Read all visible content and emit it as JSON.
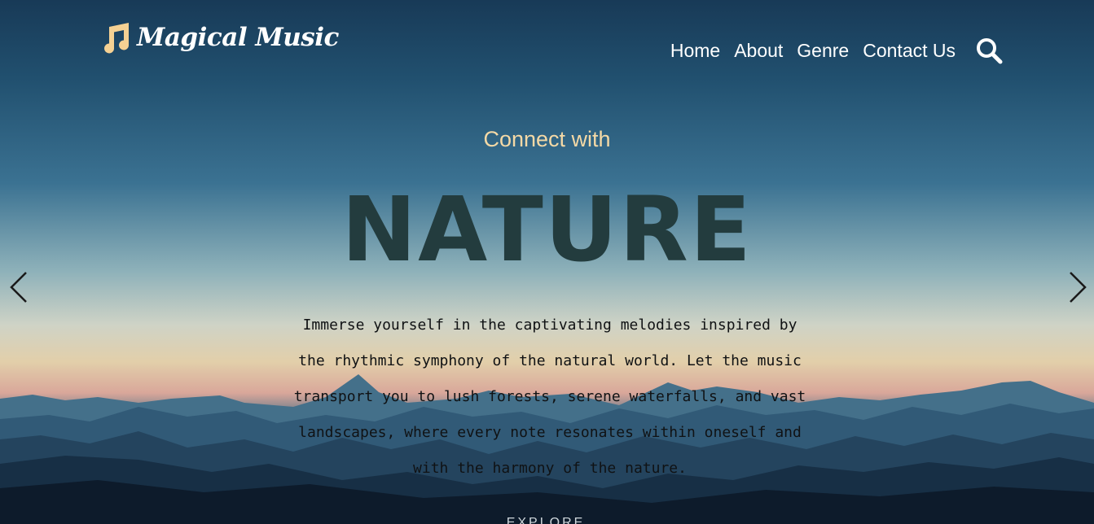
{
  "brand": {
    "name": "Magical Music",
    "icon": "music-note-icon",
    "icon_color": "#f5d193"
  },
  "nav": {
    "items": [
      {
        "label": "Home"
      },
      {
        "label": "About"
      },
      {
        "label": "Genre"
      },
      {
        "label": "Contact Us"
      }
    ],
    "search_icon": "search-icon"
  },
  "hero": {
    "subtitle": "Connect with",
    "headline": "NATURE",
    "description": "Immerse yourself in the captivating melodies inspired by the rhythmic symphony of the natural world. Let the music transport you to lush forests, serene waterfalls, and vast landscapes, where every note resonates within oneself and with the harmony of the nature.",
    "cta_label": "EXPLORE",
    "prev_icon": "chevron-left-icon",
    "next_icon": "chevron-right-icon"
  },
  "colors": {
    "subtitle": "#f4d9a6",
    "headline": "#233c3e",
    "nav_text": "#ffffff"
  }
}
